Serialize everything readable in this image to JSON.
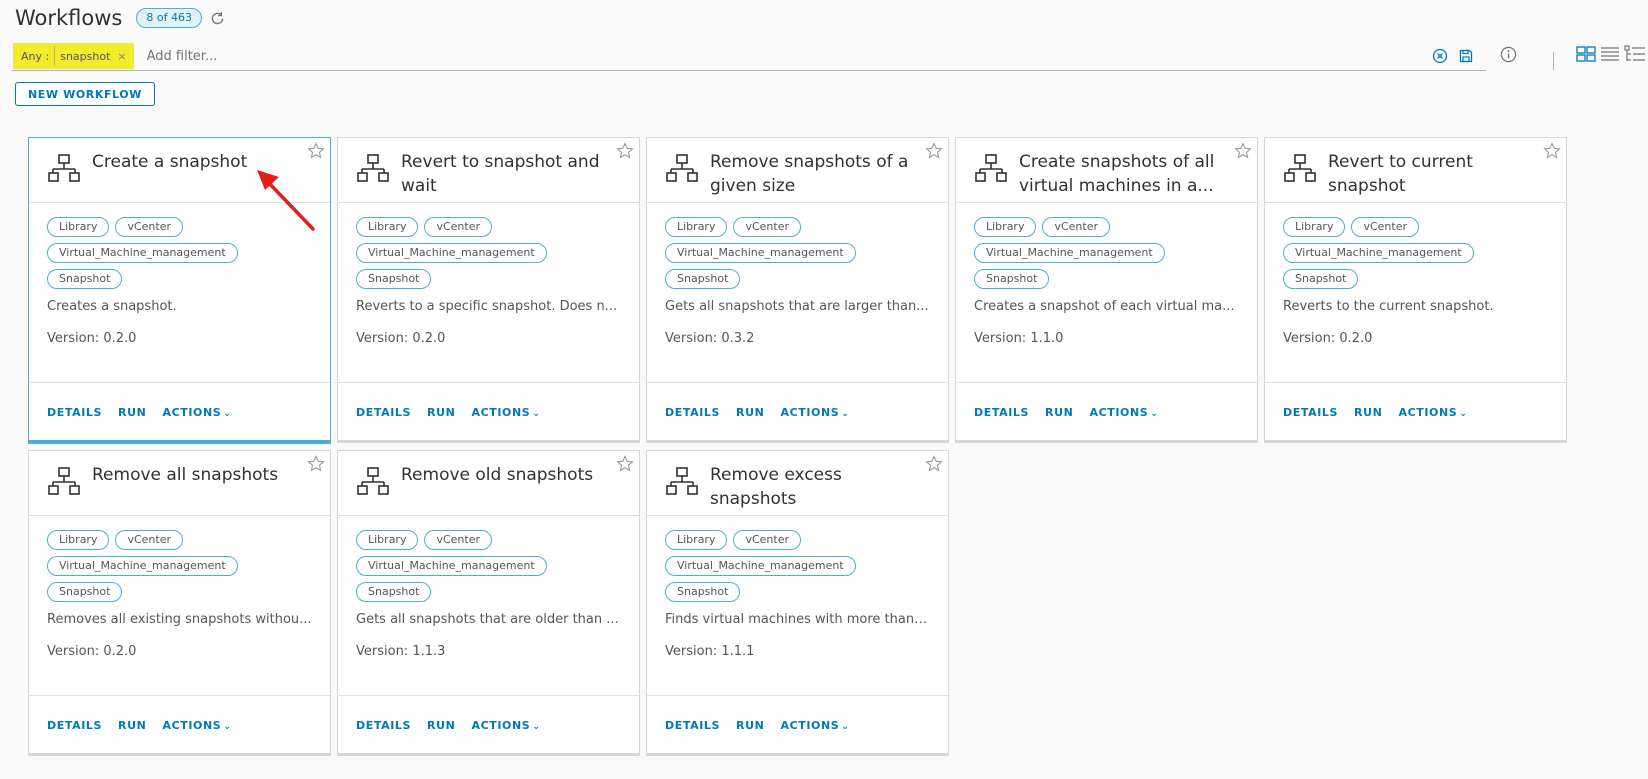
{
  "header": {
    "title": "Workflows",
    "count": "8 of 463"
  },
  "filter": {
    "chip_key": "Any :",
    "chip_value": "snapshot",
    "chip_remove": "×",
    "placeholder": "Add filter..."
  },
  "toolbar": {
    "new_workflow_label": "NEW WORKFLOW"
  },
  "card_actions": {
    "details": "DETAILS",
    "run": "RUN",
    "actions": "ACTIONS"
  },
  "cards": [
    {
      "title": "Create a snapshot",
      "tags": [
        "Library",
        "vCenter",
        "Virtual_Machine_management",
        "Snapshot"
      ],
      "description": "Creates a snapshot.",
      "version": "Version: 0.2.0"
    },
    {
      "title": "Revert to snapshot and wait",
      "tags": [
        "Library",
        "vCenter",
        "Virtual_Machine_management",
        "Snapshot"
      ],
      "description": "Reverts to a specific snapshot. Does n...",
      "version": "Version: 0.2.0"
    },
    {
      "title": "Remove snapshots of a given size",
      "tags": [
        "Library",
        "vCenter",
        "Virtual_Machine_management",
        "Snapshot"
      ],
      "description": "Gets all snapshots that are larger than...",
      "version": "Version: 0.3.2"
    },
    {
      "title": "Create snapshots of all virtual machines in a...",
      "tags": [
        "Library",
        "vCenter",
        "Virtual_Machine_management",
        "Snapshot"
      ],
      "description": "Creates a snapshot of each virtual ma...",
      "version": "Version: 1.1.0"
    },
    {
      "title": "Revert to current snapshot",
      "tags": [
        "Library",
        "vCenter",
        "Virtual_Machine_management",
        "Snapshot"
      ],
      "description": "Reverts to the current snapshot.",
      "version": "Version: 0.2.0"
    },
    {
      "title": "Remove all snapshots",
      "tags": [
        "Library",
        "vCenter",
        "Virtual_Machine_management",
        "Snapshot"
      ],
      "description": "Removes all existing snapshots withou...",
      "version": "Version: 0.2.0"
    },
    {
      "title": "Remove old snapshots",
      "tags": [
        "Library",
        "vCenter",
        "Virtual_Machine_management",
        "Snapshot"
      ],
      "description": "Gets all snapshots that are older than ...",
      "version": "Version: 1.1.3"
    },
    {
      "title": "Remove excess snapshots",
      "tags": [
        "Library",
        "vCenter",
        "Virtual_Machine_management",
        "Snapshot"
      ],
      "description": "Finds virtual machines with more than ...",
      "version": "Version: 1.1.1"
    }
  ],
  "colors": {
    "accent": "#0079b8",
    "selected_border": "#49afd9",
    "filter_highlight": "#f2ec2c",
    "annotation_arrow": "#e0201b"
  }
}
